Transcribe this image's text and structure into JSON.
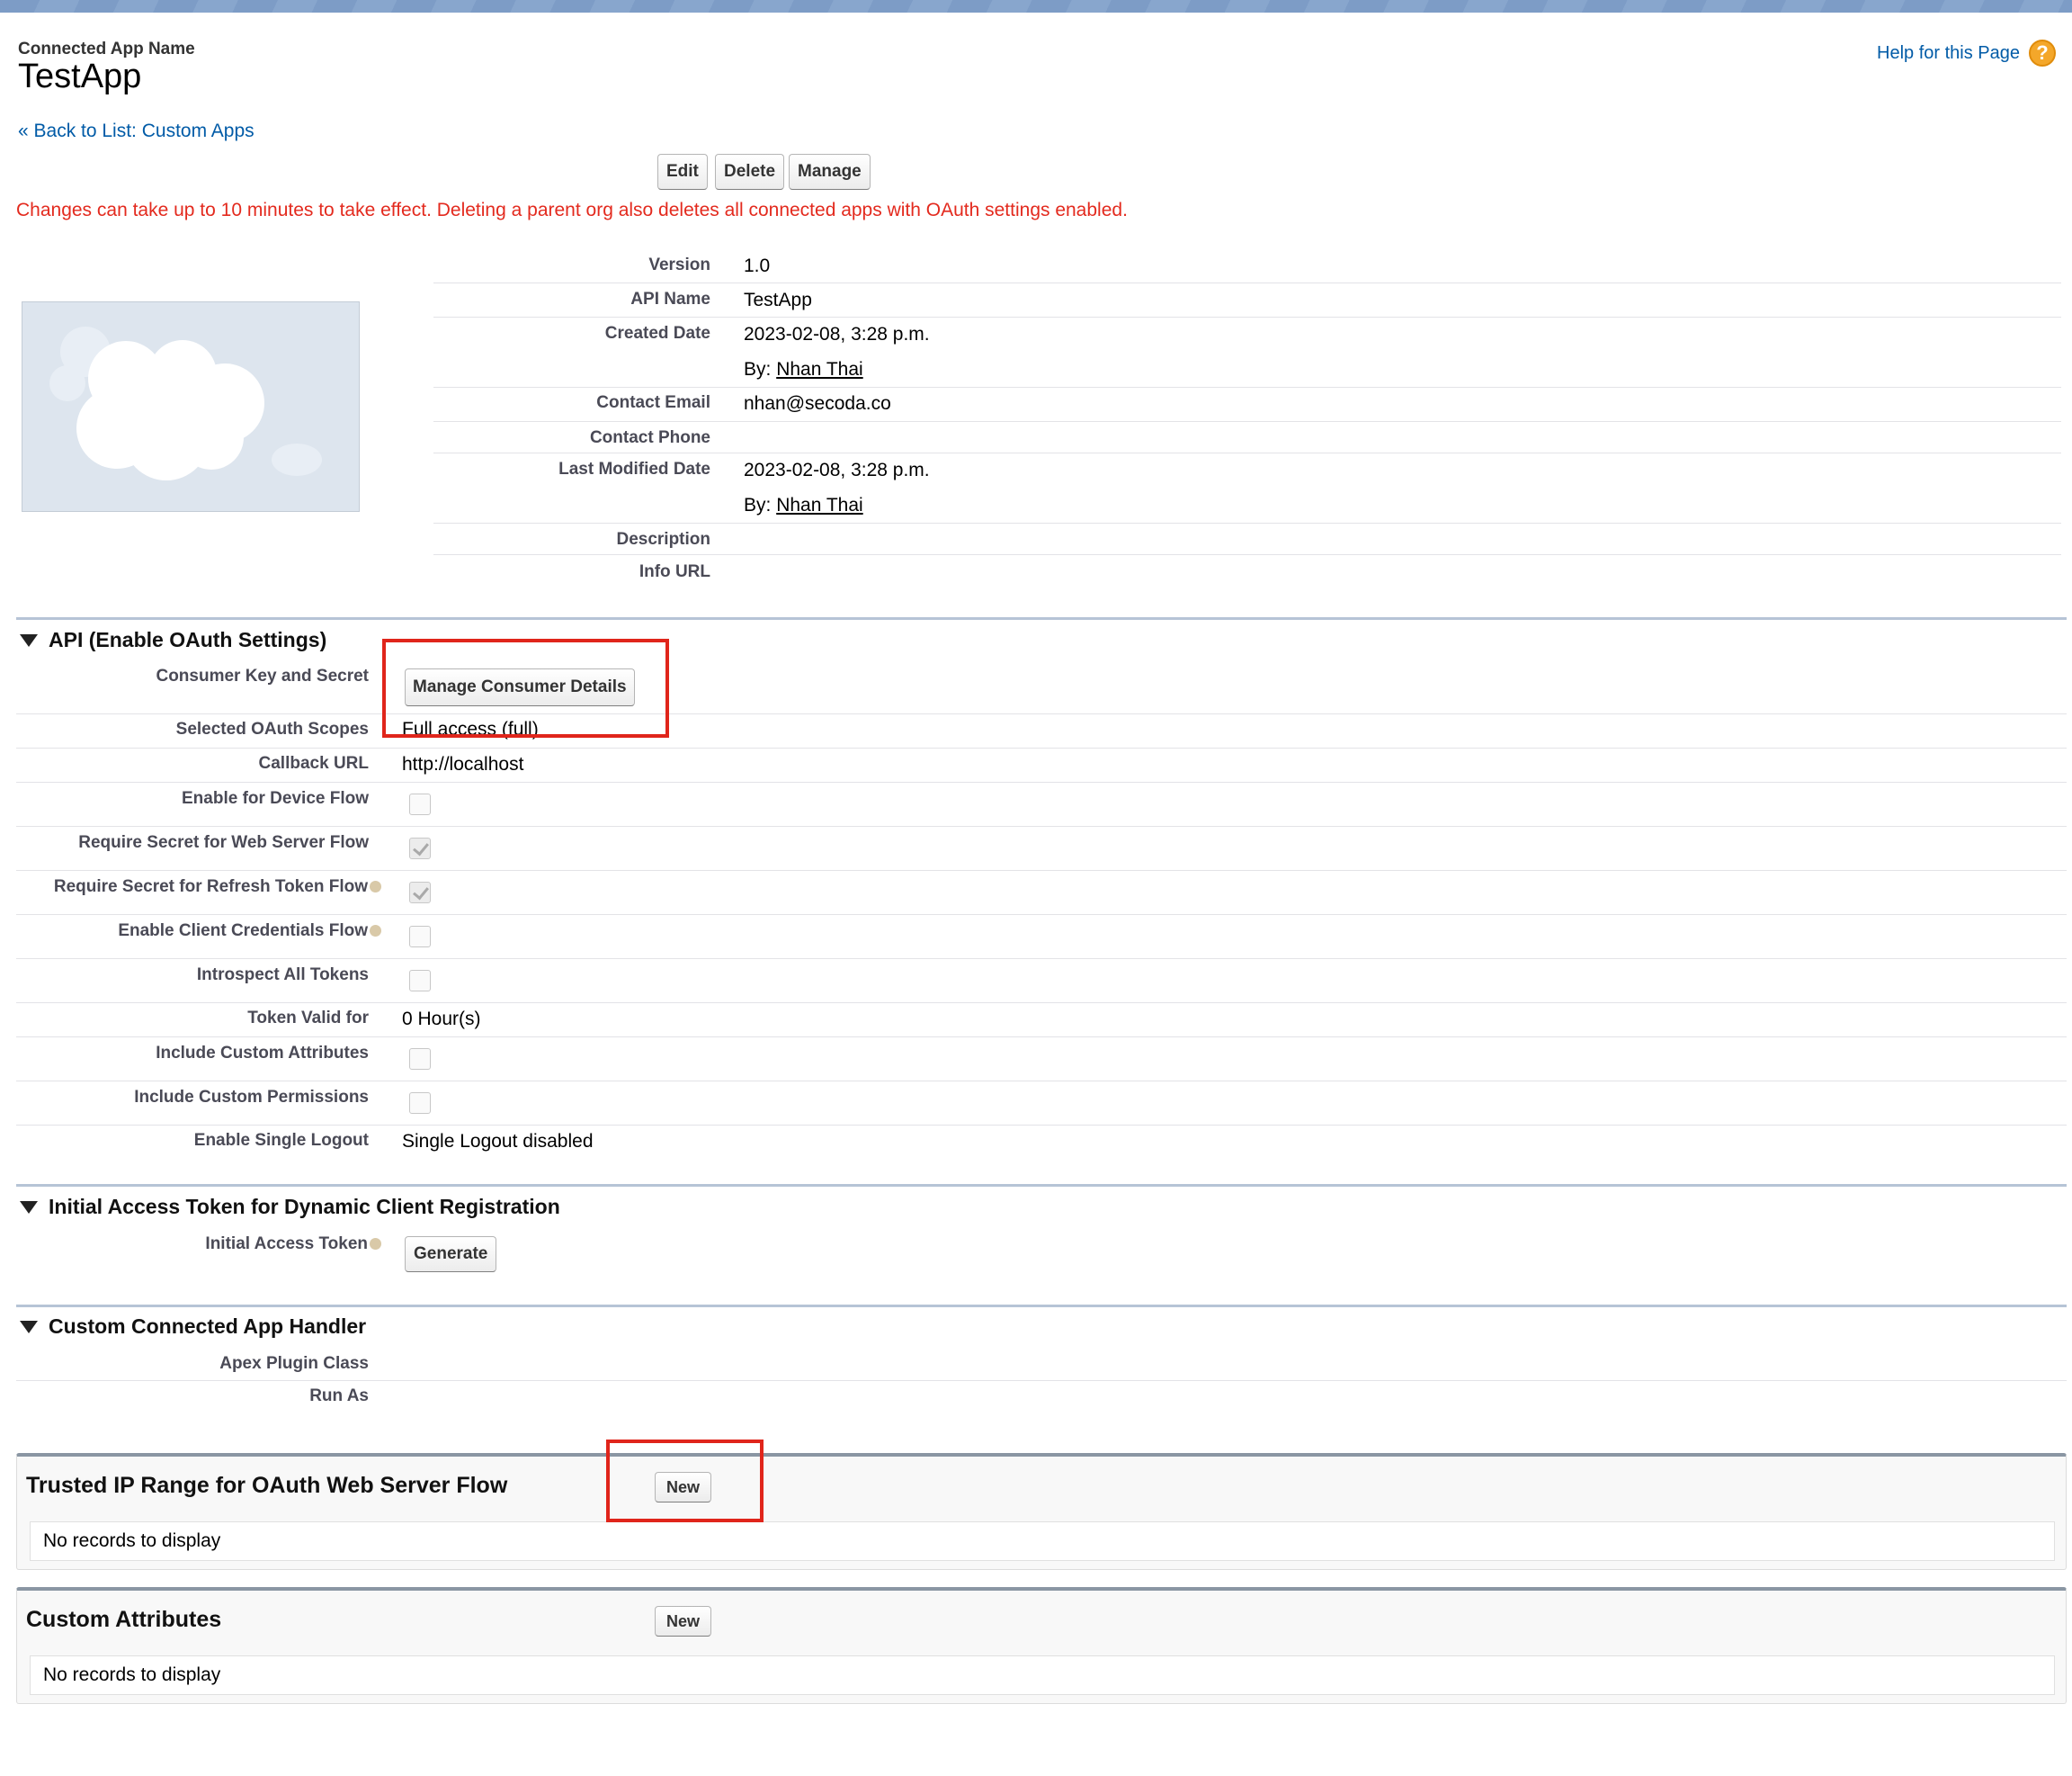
{
  "header": {
    "label": "Connected App Name",
    "title": "TestApp",
    "help_link": "Help for this Page",
    "help_icon": "?",
    "back_link": "« Back to List: Custom Apps"
  },
  "toolbar": {
    "edit": "Edit",
    "delete": "Delete",
    "manage": "Manage"
  },
  "warning": "Changes can take up to 10 minutes to take effect. Deleting a parent org also deletes all connected apps with OAuth settings enabled.",
  "details": {
    "version_label": "Version",
    "version": "1.0",
    "api_name_label": "API Name",
    "api_name": "TestApp",
    "created_label": "Created Date",
    "created": "2023-02-08, 3:28 p.m.",
    "created_by_prefix": "By:",
    "created_by": "Nhan Thai",
    "email_label": "Contact Email",
    "email": "nhan@secoda.co",
    "phone_label": "Contact Phone",
    "modified_label": "Last Modified Date",
    "modified": "2023-02-08, 3:28 p.m.",
    "modified_by_prefix": "By:",
    "modified_by": "Nhan Thai",
    "description_label": "Description",
    "info_url_label": "Info URL"
  },
  "api": {
    "title": "API (Enable OAuth Settings)",
    "consumer_label": "Consumer Key and Secret",
    "consumer_button": "Manage Consumer Details",
    "scopes_label": "Selected OAuth Scopes",
    "scopes": "Full access (full)",
    "callback_label": "Callback URL",
    "callback": "http://localhost",
    "device_flow_label": "Enable for Device Flow",
    "device_flow": false,
    "secret_web_label": "Require Secret for Web Server Flow",
    "secret_web": true,
    "secret_refresh_label": "Require Secret for Refresh Token Flow",
    "secret_refresh": true,
    "client_cred_label": "Enable Client Credentials Flow",
    "client_cred": false,
    "introspect_label": "Introspect All Tokens",
    "introspect": false,
    "token_valid_label": "Token Valid for",
    "token_valid": "0 Hour(s)",
    "custom_attr_label": "Include Custom Attributes",
    "custom_attr": false,
    "custom_perm_label": "Include Custom Permissions",
    "custom_perm": false,
    "single_logout_label": "Enable Single Logout",
    "single_logout": "Single Logout disabled"
  },
  "initial_token": {
    "title": "Initial Access Token for Dynamic Client Registration",
    "label": "Initial Access Token",
    "button": "Generate"
  },
  "handler": {
    "title": "Custom Connected App Handler",
    "apex_label": "Apex Plugin Class",
    "run_as_label": "Run As"
  },
  "trusted_ip": {
    "title": "Trusted IP Range for OAuth Web Server Flow",
    "button": "New",
    "empty": "No records to display"
  },
  "custom_attributes": {
    "title": "Custom Attributes",
    "button": "New",
    "empty": "No records to display"
  },
  "colors": {
    "link": "#015ba7",
    "warning": "#e32a1e",
    "highlight": "#e0251b"
  }
}
